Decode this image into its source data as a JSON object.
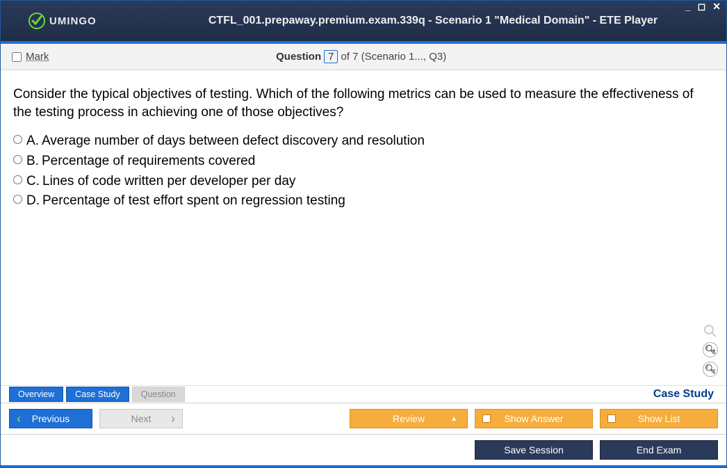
{
  "titlebar": {
    "logo_text": "UMINGO",
    "title": "CTFL_001.prepaway.premium.exam.339q - Scenario 1 \"Medical Domain\" - ETE Player"
  },
  "qheader": {
    "mark": "Mark",
    "question_label": "Question",
    "current": "7",
    "total_suffix": "of 7 (Scenario 1..., Q3)"
  },
  "question": {
    "text": "Consider the typical objectives of testing. Which of the following metrics can be used to measure the effectiveness of the testing process in achieving one of those objectives?",
    "options": [
      {
        "letter": "A.",
        "text": "Average number of days between defect discovery and resolution"
      },
      {
        "letter": "B.",
        "text": "Percentage of requirements covered"
      },
      {
        "letter": "C.",
        "text": "Lines of code written per developer per day"
      },
      {
        "letter": "D.",
        "text": "Percentage of test effort spent on regression testing"
      }
    ]
  },
  "tabs": {
    "overview": "Overview",
    "case_study": "Case Study",
    "question": "Question",
    "case_link": "Case Study"
  },
  "nav": {
    "previous": "Previous",
    "next": "Next",
    "review": "Review",
    "show_answer": "Show Answer",
    "show_list": "Show List"
  },
  "bottom": {
    "save": "Save Session",
    "end": "End Exam"
  }
}
